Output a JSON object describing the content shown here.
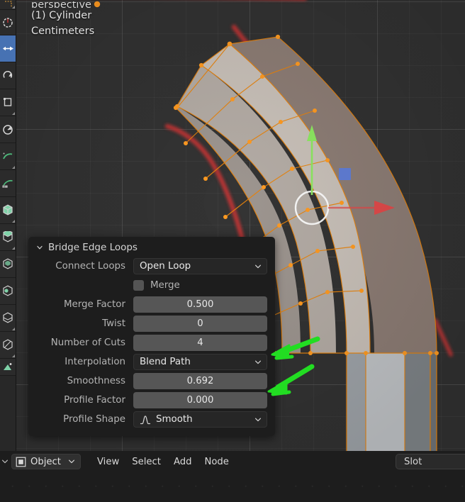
{
  "viewport": {
    "clipped_line": "perspective",
    "object_line": "(1) Cylinder",
    "units_line": "Centimeters",
    "grid_color": "#3a3a3a",
    "background_color": "#323232"
  },
  "toolbar": {
    "items": [
      {
        "name": "tweak-tool",
        "icon": "cursor-select-icon",
        "active": false
      },
      {
        "name": "select-circle-tool",
        "icon": "circle-select-icon",
        "active": false
      },
      {
        "name": "move-tool",
        "icon": "move-arrows-icon",
        "active": true
      },
      {
        "name": "rotate-tool",
        "icon": "rotate-arc-icon",
        "active": false
      },
      {
        "name": "scale-tool",
        "icon": "scale-box-icon",
        "active": false
      },
      {
        "name": "transform-tool",
        "icon": "transform-icon",
        "active": false
      },
      {
        "name": "annotate-tool",
        "icon": "annotate-pencil-icon",
        "active": false
      },
      {
        "name": "measure-tool",
        "icon": "measure-ruler-icon",
        "active": false
      },
      {
        "name": "add-cube-tool",
        "icon": "cube-add-icon",
        "active": false
      },
      {
        "name": "extrude-region-tool",
        "icon": "extrude-region-icon",
        "active": false
      },
      {
        "name": "inset-faces-tool",
        "icon": "inset-faces-icon",
        "active": false
      },
      {
        "name": "bevel-tool",
        "icon": "bevel-icon",
        "active": false
      },
      {
        "name": "loop-cut-tool",
        "icon": "loop-cut-icon",
        "active": false
      },
      {
        "name": "knife-tool",
        "icon": "knife-icon",
        "active": false
      },
      {
        "name": "poly-build-tool",
        "icon": "poly-build-icon",
        "active": false
      }
    ]
  },
  "operator_panel": {
    "title": "Bridge Edge Loops",
    "rows": [
      {
        "label": "Connect Loops",
        "value": "Open Loop",
        "type": "dropdown"
      },
      {
        "label": "Merge",
        "value": "",
        "type": "checkbox",
        "checked": false
      },
      {
        "label": "Merge Factor",
        "value": "0.500",
        "type": "number"
      },
      {
        "label": "Twist",
        "value": "0",
        "type": "number"
      },
      {
        "label": "Number of Cuts",
        "value": "4",
        "type": "number"
      },
      {
        "label": "Interpolation",
        "value": "Blend Path",
        "type": "dropdown"
      },
      {
        "label": "Smoothness",
        "value": "0.692",
        "type": "number"
      },
      {
        "label": "Profile Factor",
        "value": "0.000",
        "type": "number"
      },
      {
        "label": "Profile Shape",
        "value": "Smooth",
        "type": "dropdown",
        "icon": "bell-curve-icon"
      }
    ]
  },
  "bottom_bar": {
    "editor_mode": "Object",
    "menus": [
      "View",
      "Select",
      "Add",
      "Node"
    ],
    "slot_label": "Slot"
  },
  "annotations": {
    "arrow_color": "#22dd22",
    "curve_color": "#c03434",
    "arrows": [
      {
        "name": "arrow-number-of-cuts",
        "points_to": "Number of Cuts"
      },
      {
        "name": "arrow-smoothness",
        "points_to": "Smoothness"
      }
    ]
  },
  "colors": {
    "mesh_edge": "#e8820a",
    "vertex": "#ff9a20",
    "gizmo_y": "#8ce860",
    "gizmo_x": "#e04a4a",
    "gizmo_z": "#5a7de0",
    "accent_blue": "#4772b3"
  }
}
